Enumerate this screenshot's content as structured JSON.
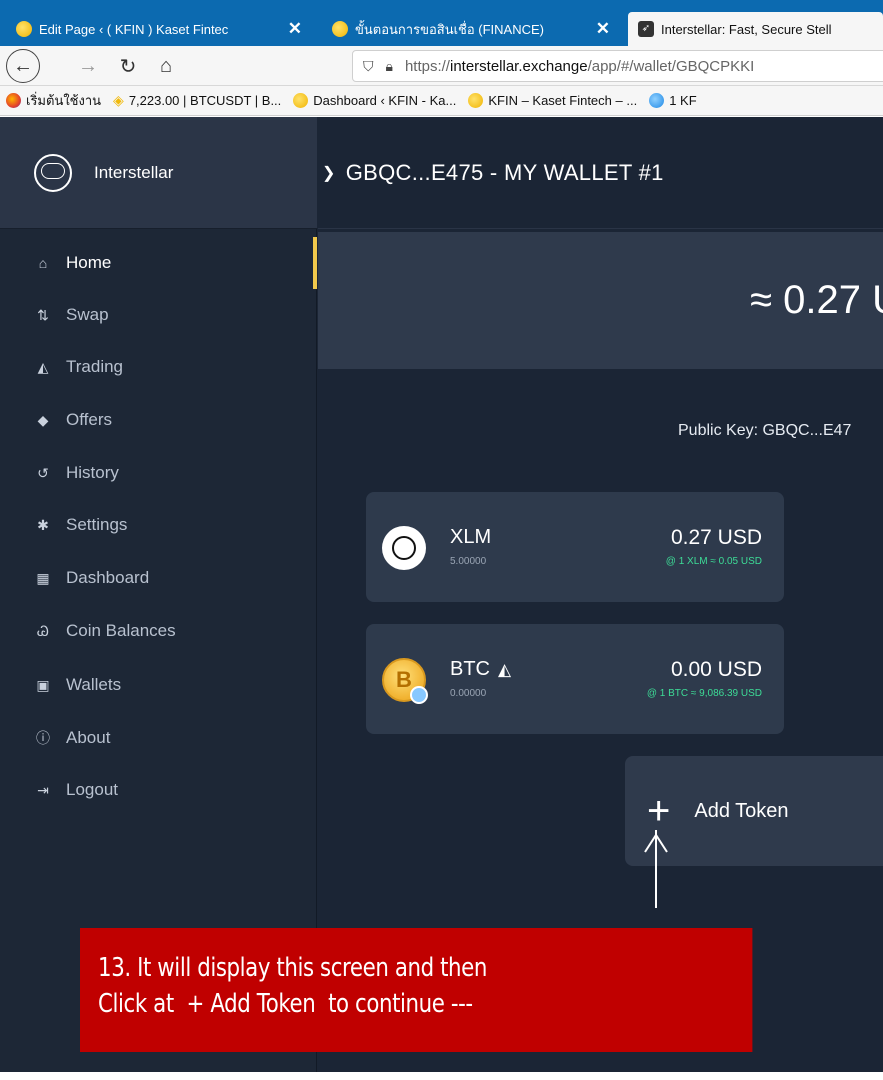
{
  "browser": {
    "tabs": [
      {
        "title": "Edit Page ‹ ( KFIN ) Kaset Fintec",
        "close": "✕"
      },
      {
        "title": "ขั้นตอนการขอสินเชื่อ (FINANCE)",
        "close": "✕"
      },
      {
        "title": "Interstellar: Fast, Secure Stell",
        "close": ""
      }
    ],
    "nav": {
      "back": "←",
      "forward": "→",
      "reload": "↻",
      "home": "⌂"
    },
    "url": {
      "prefix": "https://",
      "host": "interstellar.exchange",
      "path": "/app/#/wallet/GBQCPKKI"
    },
    "bookmarks": [
      "เริ่มต้นใช้งาน",
      "7,223.00 | BTCUSDT | B...",
      "Dashboard ‹ KFIN - Ka...",
      "KFIN – Kaset Fintech – ...",
      "1 KF"
    ]
  },
  "sidebar": {
    "brand": "Interstellar",
    "items": [
      {
        "label": "Home",
        "icon": "home-icon",
        "glyph": "⌂"
      },
      {
        "label": "Swap",
        "icon": "swap-icon",
        "glyph": "⇅"
      },
      {
        "label": "Trading",
        "icon": "chart-icon",
        "glyph": "◭"
      },
      {
        "label": "Offers",
        "icon": "basket-icon",
        "glyph": "◆"
      },
      {
        "label": "History",
        "icon": "history-icon",
        "glyph": "↺"
      },
      {
        "label": "Settings",
        "icon": "gear-icon",
        "glyph": "✱"
      },
      {
        "label": "Dashboard",
        "icon": "dashboard-icon",
        "glyph": "▦"
      },
      {
        "label": "Coin Balances",
        "icon": "coins-icon",
        "glyph": "Ꮚ"
      },
      {
        "label": "Wallets",
        "icon": "wallet-icon",
        "glyph": "▣"
      },
      {
        "label": "About",
        "icon": "info-icon",
        "glyph": "ⓘ"
      },
      {
        "label": "Logout",
        "icon": "logout-icon",
        "glyph": "⇥"
      }
    ]
  },
  "main": {
    "wallet_title": "GBQC...E475 - MY WALLET #1",
    "balance": "≈ 0.27 U",
    "public_key": "Public Key: GBQC...E47",
    "assets": [
      {
        "code": "XLM",
        "amount": "5.00000",
        "value": "0.27 USD",
        "rate": "@ 1 XLM ≈ 0.05 USD"
      },
      {
        "code": "BTC",
        "amount": "0.00000",
        "value": "0.00 USD",
        "rate": "@ 1 BTC ≈ 9,086.39 USD"
      }
    ],
    "add_token": "Add Token"
  },
  "annotation": {
    "line1": "13. It will display this screen and then",
    "line2": "Click at  + Add Token  to continue ---"
  },
  "colors": {
    "accent": "#f2c94c",
    "sidebar": "#1d2736",
    "card": "#2e3a4c",
    "rate": "#3ddc97",
    "callout": "#c00000"
  }
}
